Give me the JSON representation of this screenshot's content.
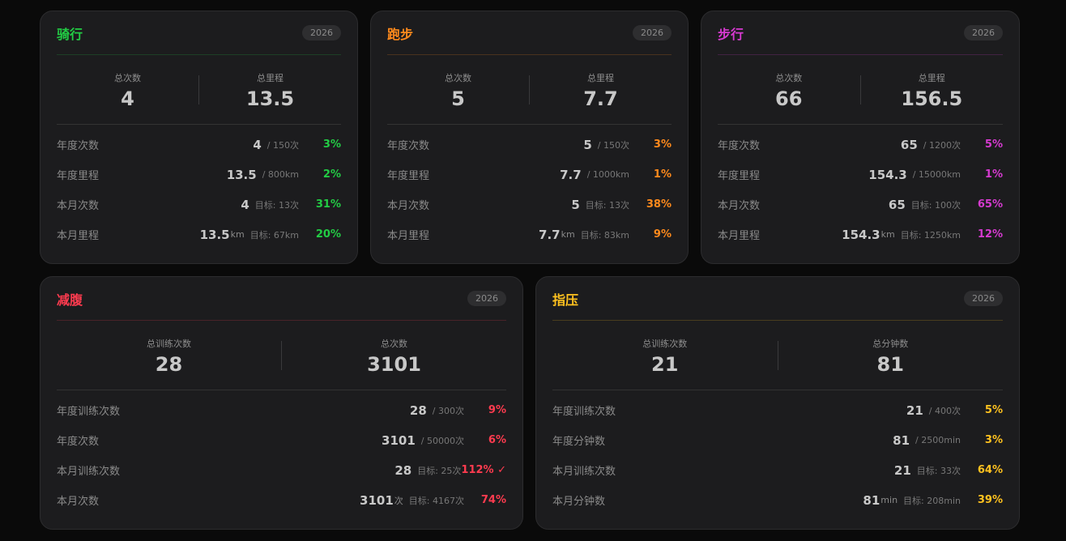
{
  "cards": [
    {
      "id": "cycling",
      "title": "骑行",
      "year": "2026",
      "color": "#22cc44",
      "summary": [
        {
          "label": "总次数",
          "value": "4"
        },
        {
          "label": "总里程",
          "value": "13.5"
        }
      ],
      "rows": [
        {
          "label": "年度次数",
          "value": "4",
          "unit": "",
          "target": "/ 150次",
          "pct": "3%"
        },
        {
          "label": "年度里程",
          "value": "13.5",
          "unit": "",
          "target": "/ 800km",
          "pct": "2%"
        },
        {
          "label": "本月次数",
          "value": "4",
          "unit": "",
          "target": "目标: 13次",
          "pct": "31%"
        },
        {
          "label": "本月里程",
          "value": "13.5",
          "unit": "km",
          "target": "目标: 67km",
          "pct": "20%"
        }
      ]
    },
    {
      "id": "running",
      "title": "跑步",
      "year": "2026",
      "color": "#ff8a1c",
      "summary": [
        {
          "label": "总次数",
          "value": "5"
        },
        {
          "label": "总里程",
          "value": "7.7"
        }
      ],
      "rows": [
        {
          "label": "年度次数",
          "value": "5",
          "unit": "",
          "target": "/ 150次",
          "pct": "3%"
        },
        {
          "label": "年度里程",
          "value": "7.7",
          "unit": "",
          "target": "/ 1000km",
          "pct": "1%"
        },
        {
          "label": "本月次数",
          "value": "5",
          "unit": "",
          "target": "目标: 13次",
          "pct": "38%"
        },
        {
          "label": "本月里程",
          "value": "7.7",
          "unit": "km",
          "target": "目标: 83km",
          "pct": "9%"
        }
      ]
    },
    {
      "id": "walking",
      "title": "步行",
      "year": "2026",
      "color": "#d63ad0",
      "summary": [
        {
          "label": "总次数",
          "value": "66"
        },
        {
          "label": "总里程",
          "value": "156.5"
        }
      ],
      "rows": [
        {
          "label": "年度次数",
          "value": "65",
          "unit": "",
          "target": "/ 1200次",
          "pct": "5%"
        },
        {
          "label": "年度里程",
          "value": "154.3",
          "unit": "",
          "target": "/ 15000km",
          "pct": "1%"
        },
        {
          "label": "本月次数",
          "value": "65",
          "unit": "",
          "target": "目标: 100次",
          "pct": "65%"
        },
        {
          "label": "本月里程",
          "value": "154.3",
          "unit": "km",
          "target": "目标: 1250km",
          "pct": "12%"
        }
      ]
    },
    {
      "id": "crunches",
      "title": "减腹",
      "year": "2026",
      "color": "#ff3b4f",
      "summary": [
        {
          "label": "总训练次数",
          "value": "28"
        },
        {
          "label": "总次数",
          "value": "3101"
        }
      ],
      "rows": [
        {
          "label": "年度训练次数",
          "value": "28",
          "unit": "",
          "target": "/ 300次",
          "pct": "9%"
        },
        {
          "label": "年度次数",
          "value": "3101",
          "unit": "",
          "target": "/ 50000次",
          "pct": "6%"
        },
        {
          "label": "本月训练次数",
          "value": "28",
          "unit": "",
          "target": "目标: 25次",
          "pct": "112% ✓"
        },
        {
          "label": "本月次数",
          "value": "3101",
          "unit": "次",
          "target": "目标: 4167次",
          "pct": "74%"
        }
      ]
    },
    {
      "id": "acupressure",
      "title": "指压",
      "year": "2026",
      "color": "#ffc21f",
      "summary": [
        {
          "label": "总训练次数",
          "value": "21"
        },
        {
          "label": "总分钟数",
          "value": "81"
        }
      ],
      "rows": [
        {
          "label": "年度训练次数",
          "value": "21",
          "unit": "",
          "target": "/ 400次",
          "pct": "5%"
        },
        {
          "label": "年度分钟数",
          "value": "81",
          "unit": "",
          "target": "/ 2500min",
          "pct": "3%"
        },
        {
          "label": "本月训练次数",
          "value": "21",
          "unit": "",
          "target": "目标: 33次",
          "pct": "64%"
        },
        {
          "label": "本月分钟数",
          "value": "81",
          "unit": "min",
          "target": "目标: 208min",
          "pct": "39%"
        }
      ]
    }
  ]
}
